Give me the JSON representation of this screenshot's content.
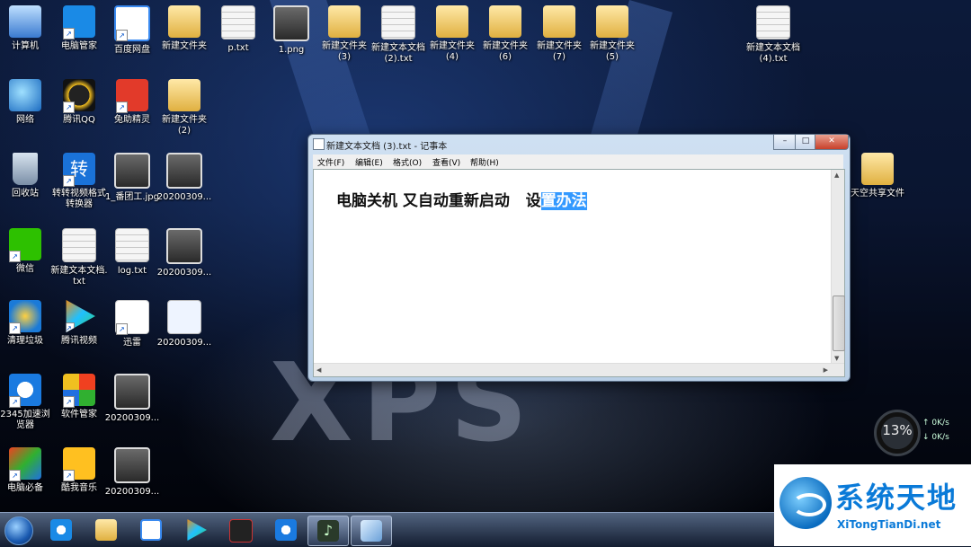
{
  "desktop": {
    "icons": [
      {
        "label": "计算机"
      },
      {
        "label": "电脑管家"
      },
      {
        "label": "百度网盘"
      },
      {
        "label": "新建文件夹"
      },
      {
        "label": "p.txt"
      },
      {
        "label": "1.png"
      },
      {
        "label": "新建文件夹 (3)"
      },
      {
        "label": "新建文本文档 (2).txt"
      },
      {
        "label": "新建文件夹 (4)"
      },
      {
        "label": "新建文件夹 (6)"
      },
      {
        "label": "新建文件夹 (7)"
      },
      {
        "label": "新建文件夹 (5)"
      },
      {
        "label": "新建文本文档 (4).txt"
      },
      {
        "label": "网络"
      },
      {
        "label": "腾讯QQ"
      },
      {
        "label": "兔助精灵"
      },
      {
        "label": "新建文件夹 (2)"
      },
      {
        "label": "回收站"
      },
      {
        "label": "转转视频格式转换器"
      },
      {
        "label": "1_番团工.jpg"
      },
      {
        "label": "20200309..."
      },
      {
        "label": "天空共享文件"
      },
      {
        "label": "微信"
      },
      {
        "label": "新建文本文档.txt"
      },
      {
        "label": "log.txt"
      },
      {
        "label": "20200309..."
      },
      {
        "label": "清理垃圾"
      },
      {
        "label": "腾讯视频"
      },
      {
        "label": "迅雷"
      },
      {
        "label": "20200309..."
      },
      {
        "label": "2345加速浏览器"
      },
      {
        "label": "软件管家"
      },
      {
        "label": "20200309..."
      },
      {
        "label": "电脑必备"
      },
      {
        "label": "酷我音乐"
      },
      {
        "label": "20200309..."
      }
    ]
  },
  "notepad": {
    "title": "新建文本文档 (3).txt - 记事本",
    "menu": [
      "文件(F)",
      "编辑(E)",
      "格式(O)",
      "查看(V)",
      "帮助(H)"
    ],
    "content_plain": "电脑关机 又自动重新启动   设",
    "content_selected": "置办法",
    "min_label": "–",
    "max_label": "□",
    "close_label": "✕"
  },
  "gauge": {
    "percent": "13%",
    "up": "0K/s",
    "down": "0K/s"
  },
  "logo": {
    "name": "系统天地",
    "url": "XiTongTianDi.net"
  },
  "taskbar": {
    "items": [
      "start",
      "ie",
      "explorer",
      "baidu-netdisk",
      "tencent-video",
      "media-app",
      "2345-browser",
      "music-app",
      "notepad"
    ]
  },
  "colors": {
    "selection": "#3399ff",
    "accent": "#0a7ad8"
  }
}
